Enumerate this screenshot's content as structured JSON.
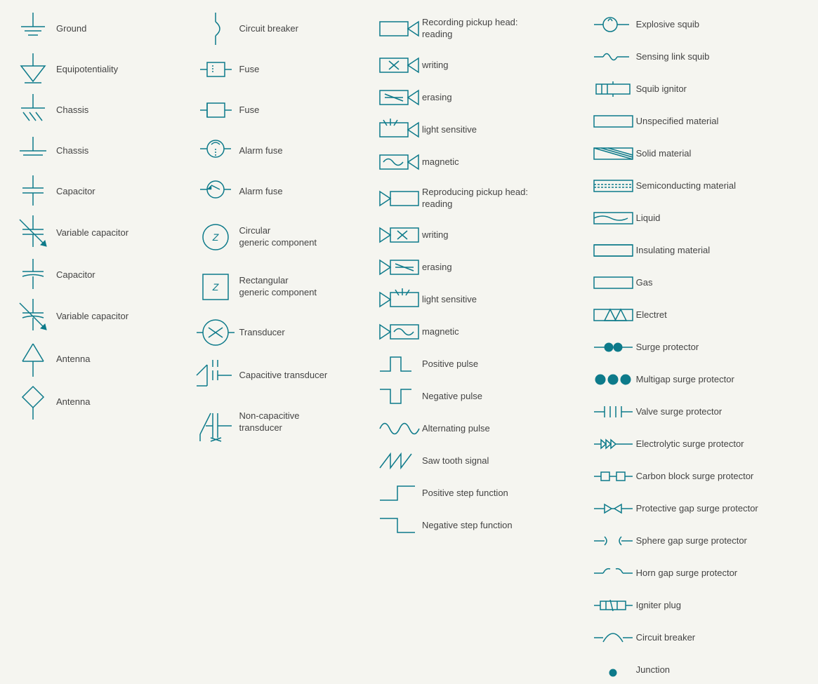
{
  "col1": {
    "items": [
      {
        "id": "ground",
        "label": "Ground"
      },
      {
        "id": "equipotentiality",
        "label": "Equipotentiality"
      },
      {
        "id": "chassis1",
        "label": "Chassis"
      },
      {
        "id": "chassis2",
        "label": "Chassis"
      },
      {
        "id": "capacitor1",
        "label": "Capacitor"
      },
      {
        "id": "variable-capacitor1",
        "label": "Variable capacitor"
      },
      {
        "id": "capacitor2",
        "label": "Capacitor"
      },
      {
        "id": "variable-capacitor2",
        "label": "Variable capacitor"
      },
      {
        "id": "antenna1",
        "label": "Antenna"
      },
      {
        "id": "antenna2",
        "label": "Antenna"
      }
    ]
  },
  "col2": {
    "items": [
      {
        "id": "circuit-breaker",
        "label": "Circuit breaker"
      },
      {
        "id": "fuse1",
        "label": "Fuse"
      },
      {
        "id": "fuse2",
        "label": "Fuse"
      },
      {
        "id": "alarm-fuse1",
        "label": "Alarm fuse"
      },
      {
        "id": "alarm-fuse2",
        "label": "Alarm fuse"
      },
      {
        "id": "circular-generic",
        "label": "Circular\ngeneric component"
      },
      {
        "id": "rectangular-generic",
        "label": "Rectangular\ngeneric component"
      },
      {
        "id": "transducer",
        "label": "Transducer"
      },
      {
        "id": "capacitive-transducer",
        "label": "Capacitive transducer"
      },
      {
        "id": "non-capacitive-transducer",
        "label": "Non-capacitive\ntransducer"
      }
    ]
  },
  "col3": {
    "items": [
      {
        "id": "recording-pickup-reading",
        "label": "Recording pickup head:\nreading"
      },
      {
        "id": "recording-pickup-writing",
        "label": "writing"
      },
      {
        "id": "recording-pickup-erasing",
        "label": "erasing"
      },
      {
        "id": "recording-pickup-light",
        "label": "light sensitive"
      },
      {
        "id": "recording-pickup-magnetic",
        "label": "magnetic"
      },
      {
        "id": "reproducing-pickup-reading",
        "label": "Reproducing pickup head:\nreading"
      },
      {
        "id": "reproducing-pickup-writing",
        "label": "writing"
      },
      {
        "id": "reproducing-pickup-erasing",
        "label": "erasing"
      },
      {
        "id": "reproducing-pickup-light",
        "label": "light sensitive"
      },
      {
        "id": "reproducing-pickup-magnetic",
        "label": "magnetic"
      },
      {
        "id": "positive-pulse",
        "label": "Positive pulse"
      },
      {
        "id": "negative-pulse",
        "label": "Negative pulse"
      },
      {
        "id": "alternating-pulse",
        "label": "Alternating pulse"
      },
      {
        "id": "saw-tooth",
        "label": "Saw tooth signal"
      },
      {
        "id": "positive-step",
        "label": "Positive step function"
      },
      {
        "id": "negative-step",
        "label": "Negative step function"
      }
    ]
  },
  "col4": {
    "items": [
      {
        "id": "explosive-squib",
        "label": "Explosive squib"
      },
      {
        "id": "sensing-link-squib",
        "label": "Sensing link squib"
      },
      {
        "id": "squib-ignitor",
        "label": "Squib ignitor"
      },
      {
        "id": "unspecified-material",
        "label": "Unspecified material"
      },
      {
        "id": "solid-material",
        "label": "Solid material"
      },
      {
        "id": "semiconducting-material",
        "label": "Semiconducting material"
      },
      {
        "id": "liquid",
        "label": "Liquid"
      },
      {
        "id": "insulating-material",
        "label": "Insulating material"
      },
      {
        "id": "gas",
        "label": "Gas"
      },
      {
        "id": "electret",
        "label": "Electret"
      },
      {
        "id": "surge-protector",
        "label": "Surge protector"
      },
      {
        "id": "multigap-surge",
        "label": "Multigap surge protector"
      },
      {
        "id": "valve-surge",
        "label": "Valve surge protector"
      },
      {
        "id": "electrolytic-surge",
        "label": "Electrolytic surge protector"
      },
      {
        "id": "carbon-block-surge",
        "label": "Carbon block surge protector"
      },
      {
        "id": "protective-gap-surge",
        "label": "Protective gap surge protector"
      },
      {
        "id": "sphere-gap-surge",
        "label": "Sphere gap surge protector"
      },
      {
        "id": "horn-gap-surge",
        "label": "Horn gap surge protector"
      },
      {
        "id": "igniter-plug",
        "label": "Igniter plug"
      },
      {
        "id": "circuit-breaker2",
        "label": "Circuit breaker"
      },
      {
        "id": "junction",
        "label": "Junction"
      }
    ]
  }
}
